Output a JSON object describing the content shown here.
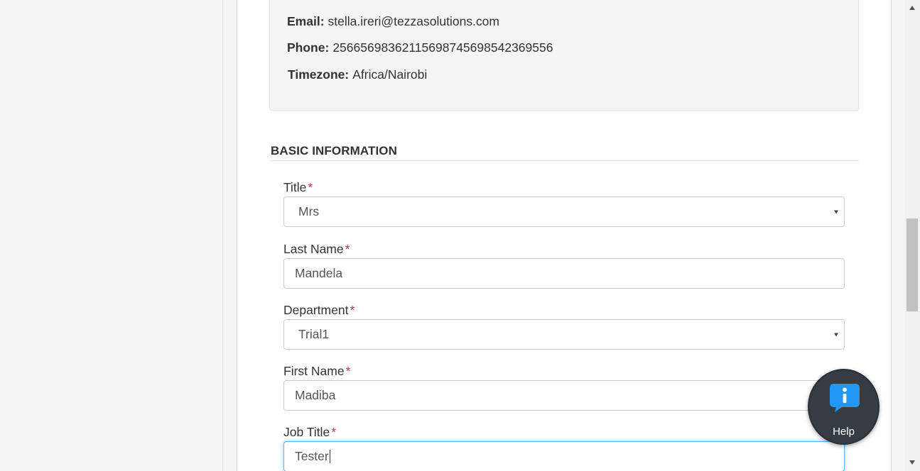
{
  "profile": {
    "email_label": "Email:",
    "email_value": "stella.ireri@tezzasolutions.com",
    "phone_label": "Phone:",
    "phone_value": "25665698362115698745698542369556",
    "timezone_label": "Timezone:",
    "timezone_value": "Africa/Nairobi"
  },
  "section": {
    "title": "BASIC INFORMATION"
  },
  "form": {
    "required_marker": "*",
    "title": {
      "label": "Title",
      "value": "Mrs"
    },
    "last_name": {
      "label": "Last Name",
      "value": "Mandela"
    },
    "department": {
      "label": "Department",
      "value": "Trial1"
    },
    "first_name": {
      "label": "First Name",
      "value": "Madiba"
    },
    "job_title": {
      "label": "Job Title",
      "value": "Tester"
    }
  },
  "help": {
    "label": "Help",
    "icon": "info-chat-icon",
    "accent": "#2196f3",
    "bg": "#353d44"
  },
  "colors": {
    "required": "#a94442",
    "focus_border": "#66afe9"
  }
}
